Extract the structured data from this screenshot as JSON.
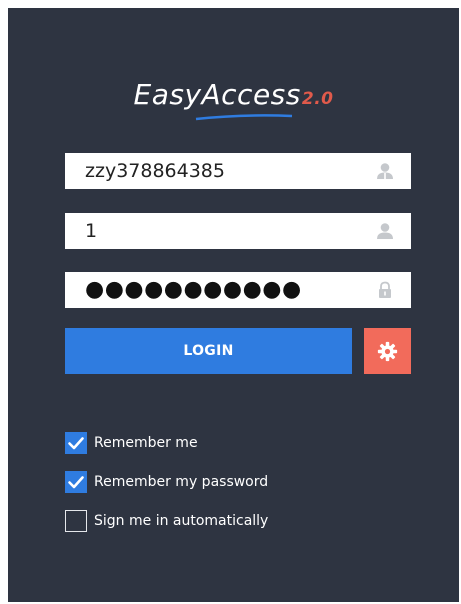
{
  "logo": {
    "text": "EasyAccess",
    "version": "2.0"
  },
  "fields": {
    "username": {
      "value": "zzy378864385"
    },
    "code": {
      "value": "1"
    },
    "password": {
      "value": "●●●●●●●●●●●"
    }
  },
  "login_label": "LOGIN",
  "options": [
    {
      "label": "Remember me",
      "checked": true
    },
    {
      "label": "Remember my password",
      "checked": true
    },
    {
      "label": "Sign me in automatically",
      "checked": false
    }
  ],
  "colors": {
    "panel": "#2e3441",
    "accent": "#2f7ce0",
    "settings": "#f26b5b",
    "logo_version": "#e05a4b"
  },
  "icons": [
    "user-icon",
    "lock-icon",
    "gear-icon",
    "check-icon"
  ]
}
